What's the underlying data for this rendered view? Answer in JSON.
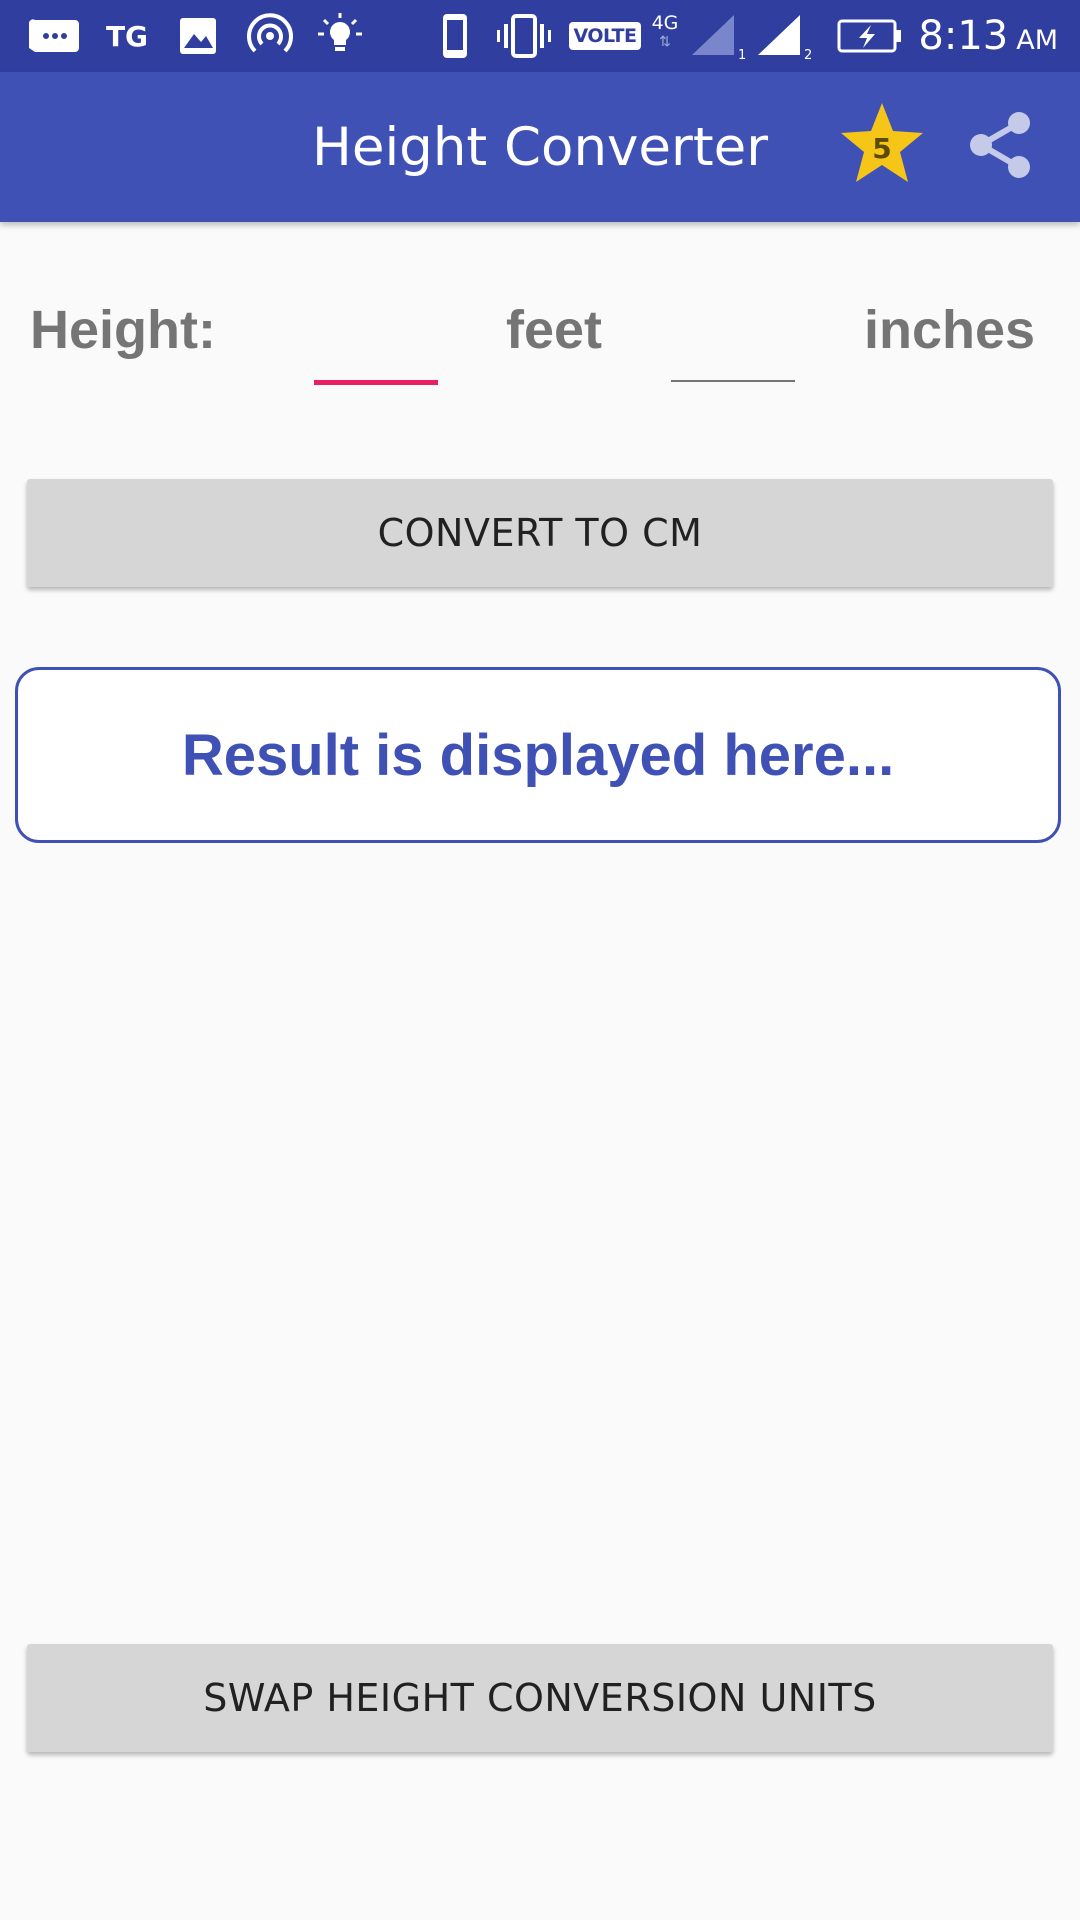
{
  "status_bar": {
    "time": "8:13",
    "ampm": "AM",
    "carrier_tag": "TG",
    "network_badge": "VOLTE",
    "network_type": "4G",
    "sim1_label": "1",
    "sim2_label": "2",
    "icons": [
      "messages-icon",
      "tg-icon",
      "image-icon",
      "hotspot-icon",
      "lightbulb-icon",
      "phone-icon",
      "vibrate-icon",
      "volte-icon",
      "signal-icon",
      "signal-icon",
      "battery-charging-icon"
    ]
  },
  "app_bar": {
    "title": "Height Converter",
    "rating_badge": "5",
    "accent_color": "#3f51b5",
    "status_color": "#303f9f",
    "star_color": "#f5c518"
  },
  "form": {
    "height_label": "Height:",
    "feet_value": "",
    "feet_unit": "feet",
    "inches_value": "",
    "inches_unit": "inches",
    "focus_color": "#e91e63"
  },
  "buttons": {
    "convert_label": "CONVERT TO CM",
    "swap_label": "SWAP HEIGHT CONVERSION UNITS"
  },
  "result": {
    "text": "Result is displayed here..."
  }
}
